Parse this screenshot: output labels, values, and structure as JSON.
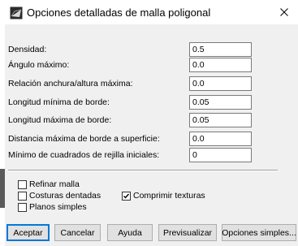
{
  "window": {
    "title": "Opciones detalladas de malla poligonal",
    "icon": "mesh-app-icon",
    "close_glyph": "✕"
  },
  "fields": [
    {
      "label": "Densidad:",
      "value": "0.5"
    },
    {
      "label": "Ángulo máximo:",
      "value": "0.0"
    },
    {
      "label": "Relación anchura/altura máxima:",
      "value": "0.0"
    },
    {
      "label": "Longitud mínima de borde:",
      "value": "0.05"
    },
    {
      "label": "Longitud máxima de borde:",
      "value": "0.05"
    },
    {
      "label": "Distancia máxima de borde a superficie:",
      "value": "0.0"
    },
    {
      "label": "Mínimo de cuadrados de rejilla iniciales:",
      "value": "0"
    }
  ],
  "options": {
    "refine": {
      "label": "Refinar malla",
      "checked": false
    },
    "jagged": {
      "label": "Costuras dentadas",
      "checked": false
    },
    "compress": {
      "label": "Comprimir texturas",
      "checked": true
    },
    "planar": {
      "label": "Planos simples",
      "checked": false
    }
  },
  "buttons": {
    "accept": "Aceptar",
    "cancel": "Cancelar",
    "help": "Ayuda",
    "preview": "Previsualizar",
    "simple": "Opciones simples..."
  }
}
